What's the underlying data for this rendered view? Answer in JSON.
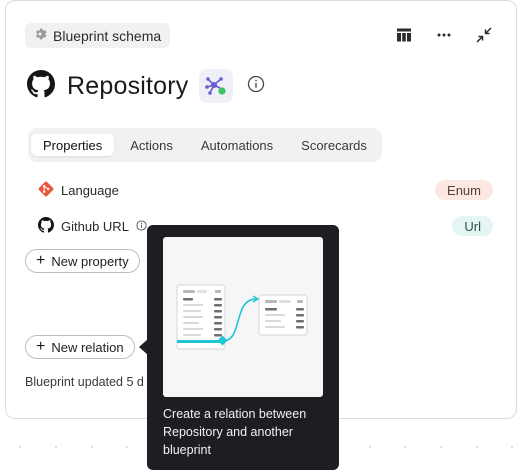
{
  "header": {
    "schema_chip_label": "Blueprint schema"
  },
  "blueprint": {
    "title": "Repository"
  },
  "tabs": [
    {
      "label": "Properties",
      "active": true
    },
    {
      "label": "Actions",
      "active": false
    },
    {
      "label": "Automations",
      "active": false
    },
    {
      "label": "Scorecards",
      "active": false
    }
  ],
  "properties": [
    {
      "name": "Language",
      "icon": "git-icon",
      "type": "Enum"
    },
    {
      "name": "Github URL",
      "icon": "github-icon",
      "type": "Url"
    }
  ],
  "buttons": {
    "new_property": "New property",
    "new_relation": "New relation"
  },
  "footer": {
    "updated_text": "Blueprint updated 5 d"
  },
  "tooltip": {
    "text": "Create a relation between Repository and another blueprint"
  },
  "colors": {
    "enum_badge_bg": "#fde7e2",
    "url_badge_bg": "#e4f5f3",
    "tooltip_bg": "#1d1d22",
    "git_orange": "#e8553a",
    "relation_accent": "#1fc7d4",
    "status_green": "#3cc36a",
    "blueprint_purple": "#6a5cd6"
  }
}
